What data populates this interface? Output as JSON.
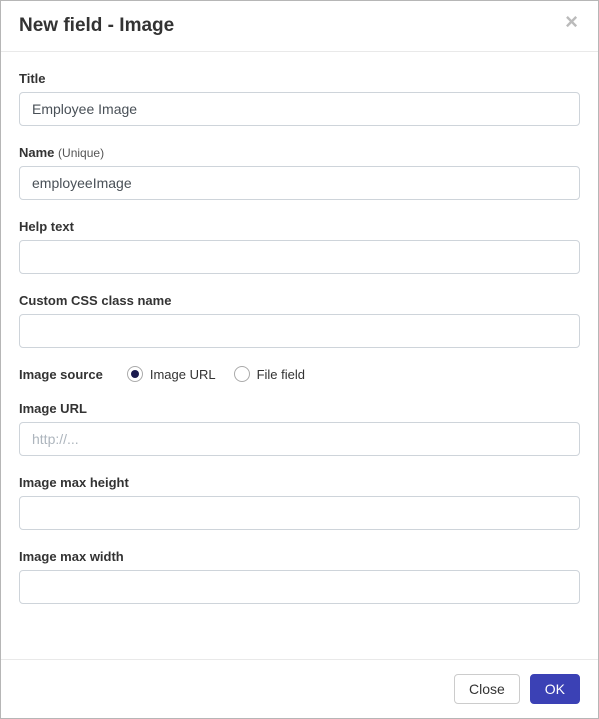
{
  "header": {
    "title": "New field - Image"
  },
  "fields": {
    "title": {
      "label": "Title",
      "value": "Employee Image"
    },
    "name": {
      "label": "Name",
      "hint": "(Unique)",
      "value": "employeeImage"
    },
    "helpText": {
      "label": "Help text",
      "value": ""
    },
    "cssClass": {
      "label": "Custom CSS class name",
      "value": ""
    },
    "imageSource": {
      "label": "Image source",
      "options": {
        "url": "Image URL",
        "fileField": "File field"
      },
      "selected": "url"
    },
    "imageUrl": {
      "label": "Image URL",
      "value": "",
      "placeholder": "http://..."
    },
    "maxHeight": {
      "label": "Image max height",
      "value": ""
    },
    "maxWidth": {
      "label": "Image max width",
      "value": ""
    }
  },
  "footer": {
    "close": "Close",
    "ok": "OK"
  }
}
